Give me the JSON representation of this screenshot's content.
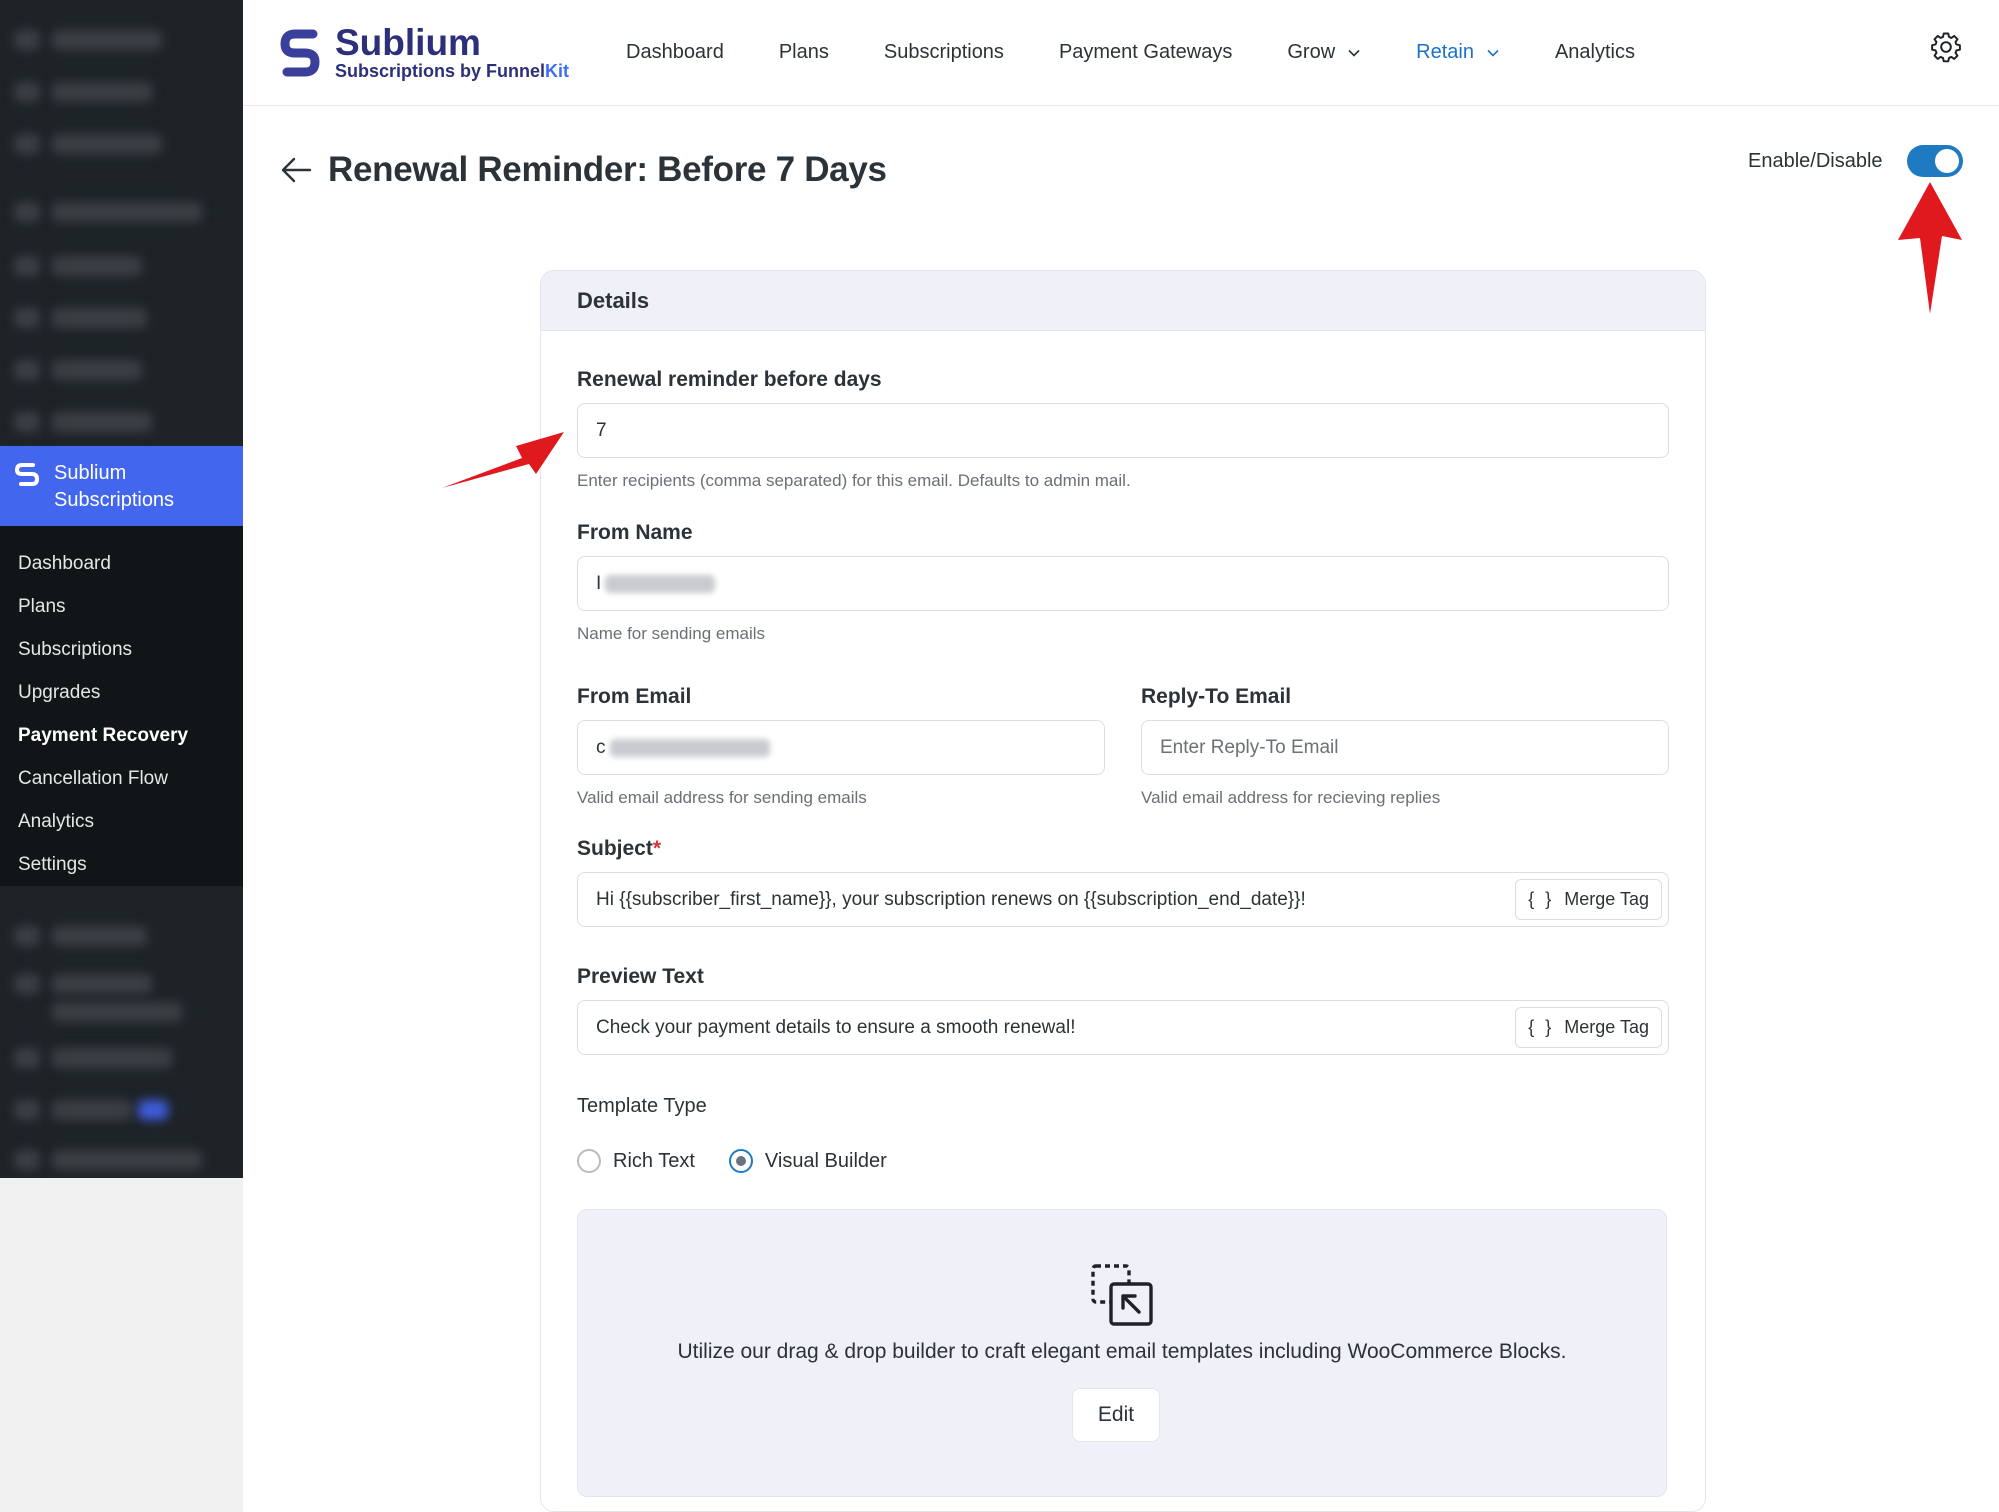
{
  "sidebar": {
    "plugin_label": "Sublium\nSubscriptions",
    "items": [
      {
        "label": "Dashboard"
      },
      {
        "label": "Plans"
      },
      {
        "label": "Subscriptions"
      },
      {
        "label": "Upgrades"
      },
      {
        "label": "Payment Recovery",
        "active": true
      },
      {
        "label": "Cancellation Flow"
      },
      {
        "label": "Analytics"
      },
      {
        "label": "Settings"
      }
    ]
  },
  "brand": {
    "name": "Sublium",
    "tagline_prefix": "Subscriptions by Funnel",
    "tagline_suffix": "Kit"
  },
  "nav": {
    "items": [
      {
        "label": "Dashboard"
      },
      {
        "label": "Plans"
      },
      {
        "label": "Subscriptions"
      },
      {
        "label": "Payment Gateways"
      },
      {
        "label": "Grow",
        "dropdown": true
      },
      {
        "label": "Retain",
        "dropdown": true,
        "active": true
      },
      {
        "label": "Analytics"
      }
    ]
  },
  "page": {
    "title": "Renewal Reminder: Before 7 Days",
    "toggle_label": "Enable/Disable",
    "enabled": true
  },
  "card": {
    "title": "Details",
    "days": {
      "label": "Renewal reminder before days",
      "value": "7",
      "help": "Enter recipients (comma separated) for this email. Defaults to admin mail."
    },
    "from_name": {
      "label": "From Name",
      "value": "I",
      "help": "Name for sending emails"
    },
    "from_email": {
      "label": "From Email",
      "value": "c",
      "help": "Valid email address for sending emails"
    },
    "reply_to": {
      "label": "Reply-To Email",
      "placeholder": "Enter Reply-To Email",
      "help": "Valid email address for recieving replies"
    },
    "subject": {
      "label": "Subject",
      "required_mark": "*",
      "value": "Hi {{subscriber_first_name}}, your subscription renews on {{subscription_end_date}}!"
    },
    "preview": {
      "label": "Preview Text",
      "value": "Check your payment details to ensure a smooth renewal!"
    },
    "merge_tag": {
      "brace": "{ }",
      "label": "Merge Tag"
    },
    "template": {
      "label": "Template Type",
      "options": [
        {
          "label": "Rich Text",
          "checked": false
        },
        {
          "label": "Visual Builder",
          "checked": true
        }
      ]
    },
    "builder": {
      "description": "Utilize our drag & drop builder to craft elegant email templates including WooCommerce Blocks.",
      "edit_label": "Edit"
    }
  },
  "colors": {
    "accent": "#1e7bc1",
    "brand": "#2d2f7a",
    "sidebar_active": "#4266ed",
    "annotation": "#e0191e"
  },
  "icons": [
    "sublium-logo-icon",
    "chevron-down-icon",
    "gear-icon",
    "back-arrow-icon",
    "drag-drop-icon",
    "annotation-arrow-icon"
  ]
}
